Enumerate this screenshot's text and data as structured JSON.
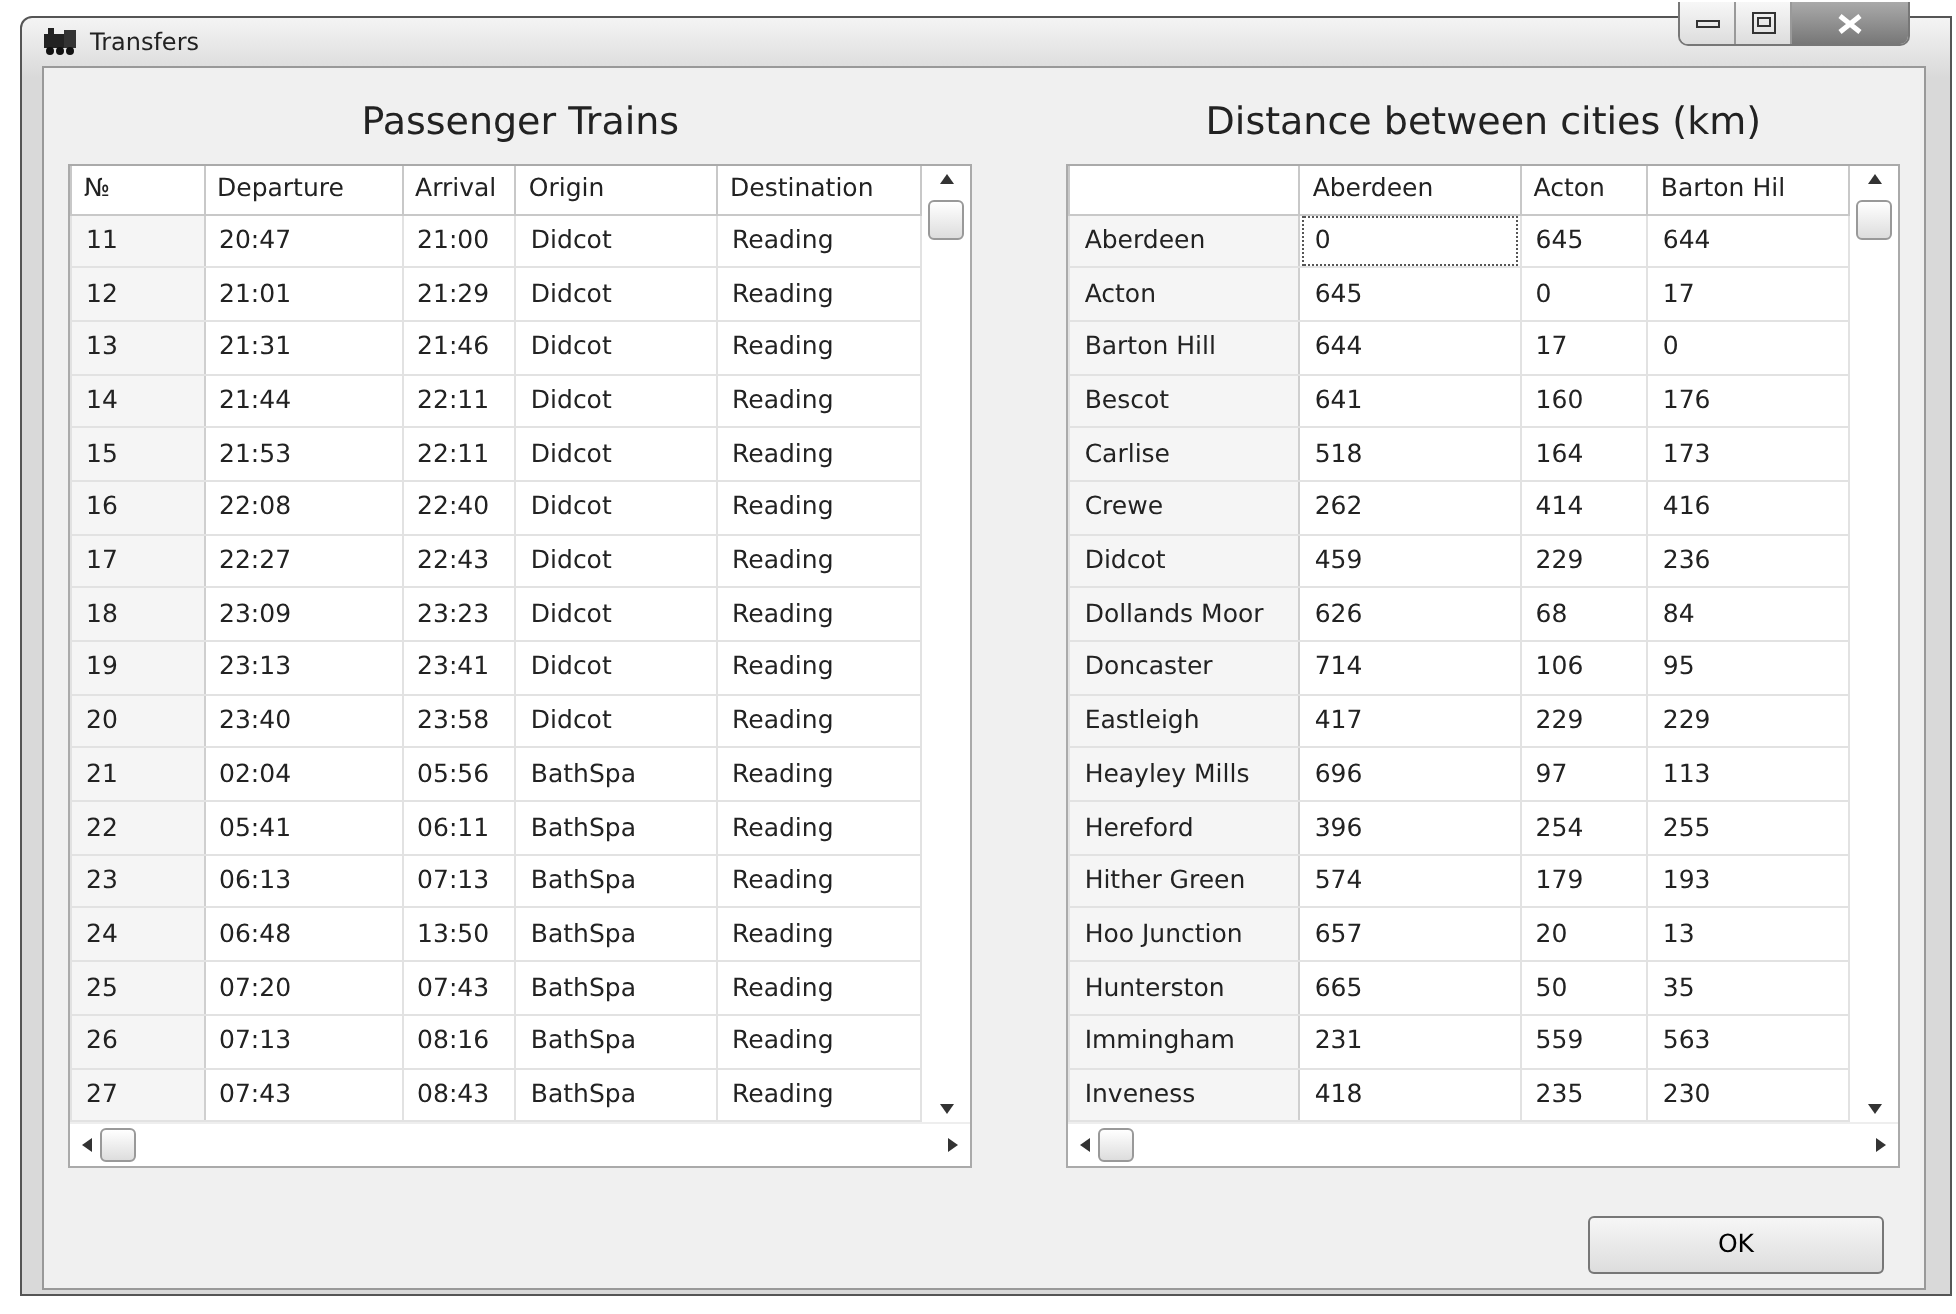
{
  "window": {
    "title": "Transfers"
  },
  "trains": {
    "title": "Passenger Trains",
    "columns": [
      "№",
      "Departure",
      "Arrival",
      "Origin",
      "Destination"
    ],
    "rows": [
      [
        "11",
        "20:47",
        "21:00",
        "Didcot",
        "Reading"
      ],
      [
        "12",
        "21:01",
        "21:29",
        "Didcot",
        "Reading"
      ],
      [
        "13",
        "21:31",
        "21:46",
        "Didcot",
        "Reading"
      ],
      [
        "14",
        "21:44",
        "22:11",
        "Didcot",
        "Reading"
      ],
      [
        "15",
        "21:53",
        "22:11",
        "Didcot",
        "Reading"
      ],
      [
        "16",
        "22:08",
        "22:40",
        "Didcot",
        "Reading"
      ],
      [
        "17",
        "22:27",
        "22:43",
        "Didcot",
        "Reading"
      ],
      [
        "18",
        "23:09",
        "23:23",
        "Didcot",
        "Reading"
      ],
      [
        "19",
        "23:13",
        "23:41",
        "Didcot",
        "Reading"
      ],
      [
        "20",
        "23:40",
        "23:58",
        "Didcot",
        "Reading"
      ],
      [
        "21",
        "02:04",
        "05:56",
        "BathSpa",
        "Reading"
      ],
      [
        "22",
        "05:41",
        "06:11",
        "BathSpa",
        "Reading"
      ],
      [
        "23",
        "06:13",
        "07:13",
        "BathSpa",
        "Reading"
      ],
      [
        "24",
        "06:48",
        "13:50",
        "BathSpa",
        "Reading"
      ],
      [
        "25",
        "07:20",
        "07:43",
        "BathSpa",
        "Reading"
      ],
      [
        "26",
        "07:13",
        "08:16",
        "BathSpa",
        "Reading"
      ],
      [
        "27",
        "07:43",
        "08:43",
        "BathSpa",
        "Reading"
      ]
    ]
  },
  "distances": {
    "title": "Distance between cities (km)",
    "columns": [
      "Aberdeen",
      "Acton",
      "Barton Hil"
    ],
    "rows": [
      {
        "city": "Aberdeen",
        "cells": [
          {
            "value": "0",
            "focused": true
          },
          {
            "value": "645",
            "focused": false
          },
          {
            "value": "644",
            "focused": false
          }
        ]
      },
      {
        "city": "Acton",
        "cells": [
          {
            "value": "645",
            "focused": false
          },
          {
            "value": "0",
            "focused": false
          },
          {
            "value": "17",
            "focused": false
          }
        ]
      },
      {
        "city": "Barton Hill",
        "cells": [
          {
            "value": "644",
            "focused": false
          },
          {
            "value": "17",
            "focused": false
          },
          {
            "value": "0",
            "focused": false
          }
        ]
      },
      {
        "city": "Bescot",
        "cells": [
          {
            "value": "641",
            "focused": false
          },
          {
            "value": "160",
            "focused": false
          },
          {
            "value": "176",
            "focused": false
          }
        ]
      },
      {
        "city": "Carlise",
        "cells": [
          {
            "value": "518",
            "focused": false
          },
          {
            "value": "164",
            "focused": false
          },
          {
            "value": "173",
            "focused": false
          }
        ]
      },
      {
        "city": "Crewe",
        "cells": [
          {
            "value": "262",
            "focused": false
          },
          {
            "value": "414",
            "focused": false
          },
          {
            "value": "416",
            "focused": false
          }
        ]
      },
      {
        "city": "Didcot",
        "cells": [
          {
            "value": "459",
            "focused": false
          },
          {
            "value": "229",
            "focused": false
          },
          {
            "value": "236",
            "focused": false
          }
        ]
      },
      {
        "city": "Dollands Moor",
        "cells": [
          {
            "value": "626",
            "focused": false
          },
          {
            "value": "68",
            "focused": false
          },
          {
            "value": "84",
            "focused": false
          }
        ]
      },
      {
        "city": "Doncaster",
        "cells": [
          {
            "value": "714",
            "focused": false
          },
          {
            "value": "106",
            "focused": false
          },
          {
            "value": "95",
            "focused": false
          }
        ]
      },
      {
        "city": "Eastleigh",
        "cells": [
          {
            "value": "417",
            "focused": false
          },
          {
            "value": "229",
            "focused": false
          },
          {
            "value": "229",
            "focused": false
          }
        ]
      },
      {
        "city": "Heayley Mills",
        "cells": [
          {
            "value": "696",
            "focused": false
          },
          {
            "value": "97",
            "focused": false
          },
          {
            "value": "113",
            "focused": false
          }
        ]
      },
      {
        "city": "Hereford",
        "cells": [
          {
            "value": "396",
            "focused": false
          },
          {
            "value": "254",
            "focused": false
          },
          {
            "value": "255",
            "focused": false
          }
        ]
      },
      {
        "city": "Hither Green",
        "cells": [
          {
            "value": "574",
            "focused": false
          },
          {
            "value": "179",
            "focused": false
          },
          {
            "value": "193",
            "focused": false
          }
        ]
      },
      {
        "city": "Hoo Junction",
        "cells": [
          {
            "value": "657",
            "focused": false
          },
          {
            "value": "20",
            "focused": false
          },
          {
            "value": "13",
            "focused": false
          }
        ]
      },
      {
        "city": "Hunterston",
        "cells": [
          {
            "value": "665",
            "focused": false
          },
          {
            "value": "50",
            "focused": false
          },
          {
            "value": "35",
            "focused": false
          }
        ]
      },
      {
        "city": "Immingham",
        "cells": [
          {
            "value": "231",
            "focused": false
          },
          {
            "value": "559",
            "focused": false
          },
          {
            "value": "563",
            "focused": false
          }
        ]
      },
      {
        "city": "Inveness",
        "cells": [
          {
            "value": "418",
            "focused": false
          },
          {
            "value": "235",
            "focused": false
          },
          {
            "value": "230",
            "focused": false
          }
        ]
      }
    ]
  },
  "buttons": [
    "OK"
  ]
}
